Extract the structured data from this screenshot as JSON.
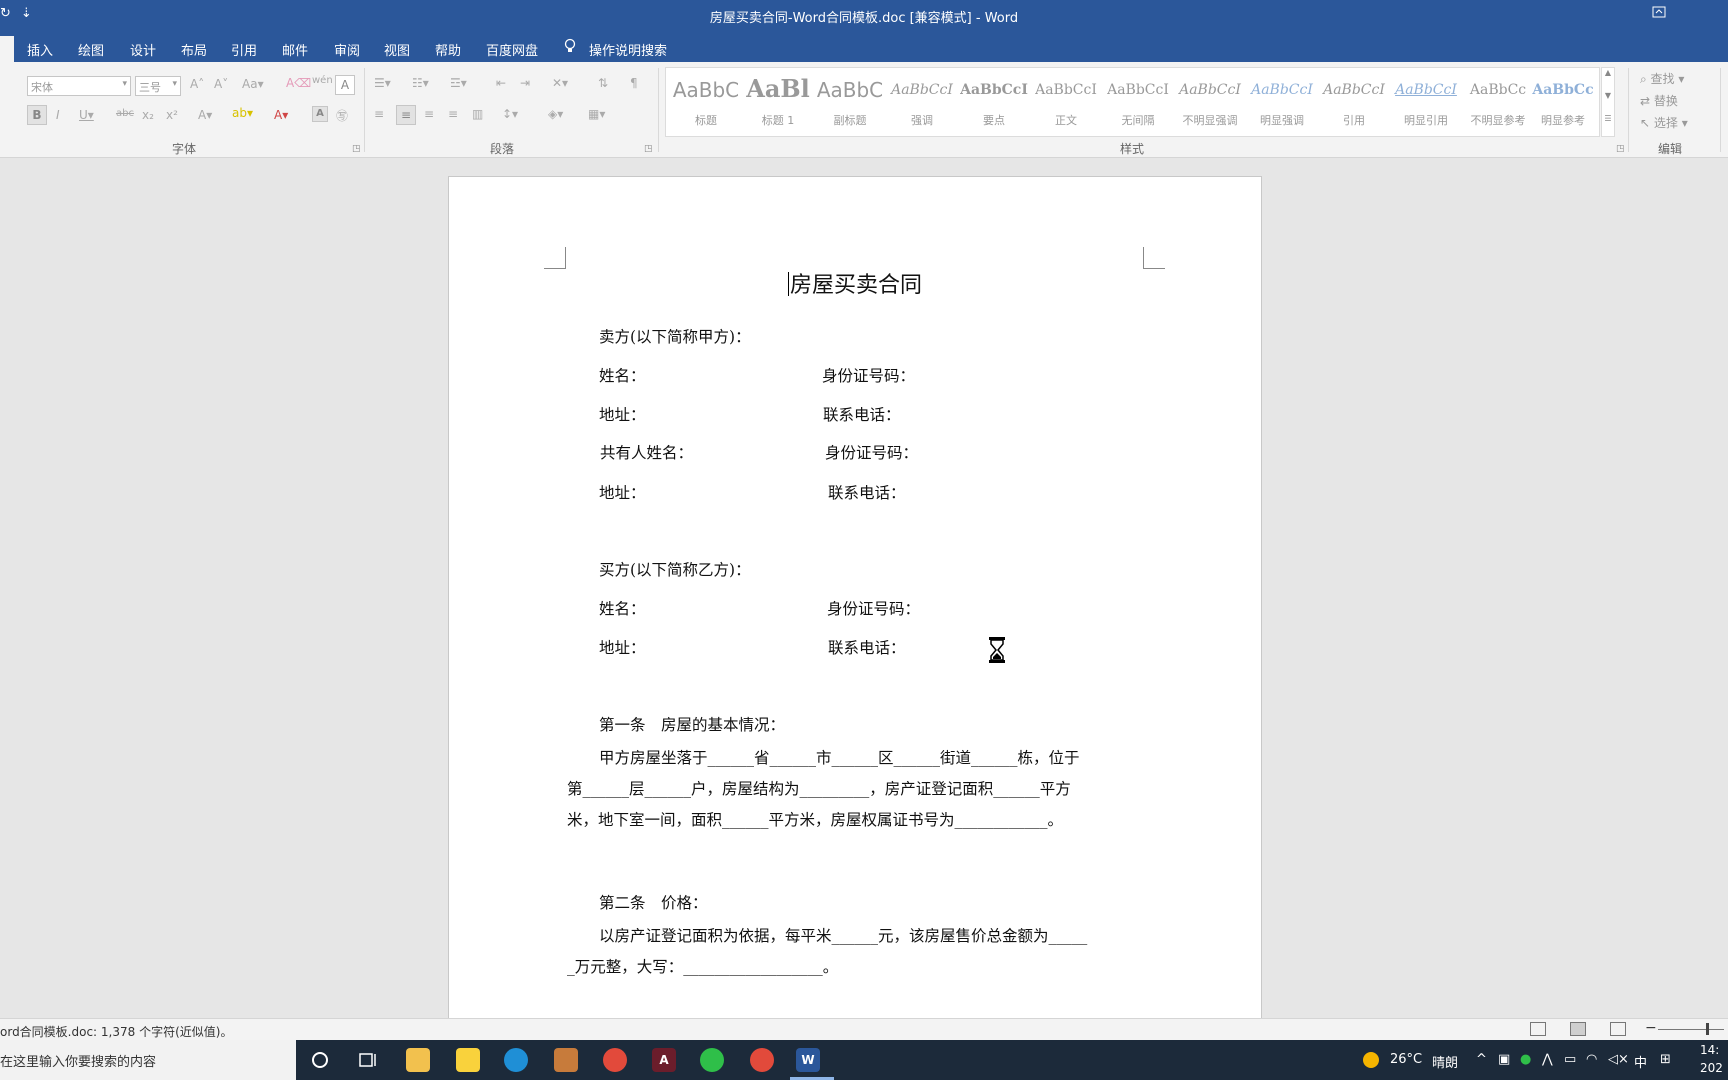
{
  "window": {
    "title": "房屋买卖合同-Word合同模板.doc [兼容模式]  -  Word",
    "quick_access": [
      "↻",
      "⇣"
    ]
  },
  "tabs": [
    "插入",
    "绘图",
    "设计",
    "布局",
    "引用",
    "邮件",
    "审阅",
    "视图",
    "帮助",
    "百度网盘"
  ],
  "tell_me": "操作说明搜索",
  "ribbon": {
    "font_name": "宋体",
    "font_size": "三号",
    "groups": {
      "font": "字体",
      "paragraph": "段落",
      "styles": "样式",
      "editing": "编辑"
    },
    "styles": [
      {
        "sample": "AaBbC",
        "name": "标题"
      },
      {
        "sample": "AaBl",
        "name": "标题 1"
      },
      {
        "sample": "AaBbC",
        "name": "副标题"
      },
      {
        "sample": "AaBbCcI",
        "name": "强调"
      },
      {
        "sample": "AaBbCcI",
        "name": "要点"
      },
      {
        "sample": "AaBbCcI",
        "name": "正文"
      },
      {
        "sample": "AaBbCcI",
        "name": "无间隔"
      },
      {
        "sample": "AaBbCcI",
        "name": "不明显强调"
      },
      {
        "sample": "AaBbCcI",
        "name": "明显强调"
      },
      {
        "sample": "AaBbCcI",
        "name": "引用"
      },
      {
        "sample": "AaBbCcI",
        "name": "明显引用"
      },
      {
        "sample": "AaBbCc",
        "name": "不明显参考"
      },
      {
        "sample": "AaBbCc",
        "name": "明显参考"
      }
    ],
    "editing": [
      "查找",
      "替换",
      "选择"
    ]
  },
  "document": {
    "title": "房屋买卖合同",
    "seller_heading": "卖方(以下简称甲方)：",
    "seller_rows": [
      {
        "left": "姓名：",
        "right": "身份证号码："
      },
      {
        "left": "地址：",
        "right": "联系电话："
      },
      {
        "left": "共有人姓名：",
        "right": "身份证号码："
      },
      {
        "left": "地址：",
        "right": "联系电话："
      }
    ],
    "buyer_heading": "买方(以下简称乙方)：",
    "buyer_rows": [
      {
        "left": "姓名：",
        "right": "身份证号码："
      },
      {
        "left": "地址：",
        "right": "联系电话："
      }
    ],
    "article1_heading": "第一条　房屋的基本情况：",
    "article1_text": "甲方房屋坐落于______省______市______区______街道______栋，位于第______层______户，房屋结构为_________，房产证登记面积______平方米，地下室一间，面积______平方米，房屋权属证书号为____________。",
    "article2_heading": "第二条　价格：",
    "article2_text": "以房产证登记面积为依据，每平米______元，该房屋售价总金额为______万元整，大写：__________________。"
  },
  "status": {
    "text": "ord合同模板.doc: 1,378 个字符(近似值)。"
  },
  "taskbar": {
    "search_placeholder": "在这里输入你要搜索的内容",
    "weather": "26°C",
    "weather_desc": "晴朗",
    "ime": "中",
    "time": "14:",
    "date": "202"
  }
}
